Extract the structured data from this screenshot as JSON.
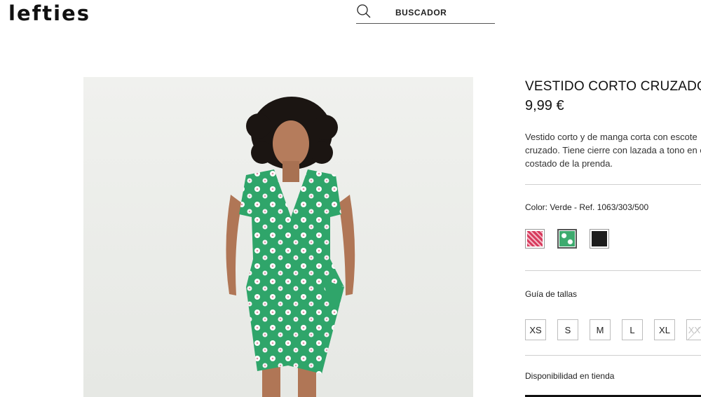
{
  "header": {
    "logo": "lefties",
    "search": {
      "label": "BUSCADOR",
      "icon": "search-icon"
    }
  },
  "product": {
    "title": "VESTIDO CORTO CRUZADO",
    "price": "9,99 €",
    "description_lines": [
      "Vestido corto y de manga corta con escote",
      "cruzado. Tiene cierre con lazada a tono en el",
      "costado de la prenda."
    ],
    "color_label": "Color: Verde - Ref. 1063/303/500",
    "swatches": [
      {
        "name": "rosa",
        "color": "#d63a5c",
        "selected": false
      },
      {
        "name": "verde",
        "color": "#3daa6e",
        "selected": true
      },
      {
        "name": "negro",
        "color": "#1c1c1c",
        "selected": false
      }
    ],
    "size_guide_label": "Guía de tallas",
    "sizes": [
      {
        "label": "XS",
        "available": true
      },
      {
        "label": "S",
        "available": true
      },
      {
        "label": "M",
        "available": true
      },
      {
        "label": "L",
        "available": true
      },
      {
        "label": "XL",
        "available": true
      },
      {
        "label": "XXL",
        "available": false
      }
    ],
    "availability_label": "Disponibilidad en tienda"
  }
}
